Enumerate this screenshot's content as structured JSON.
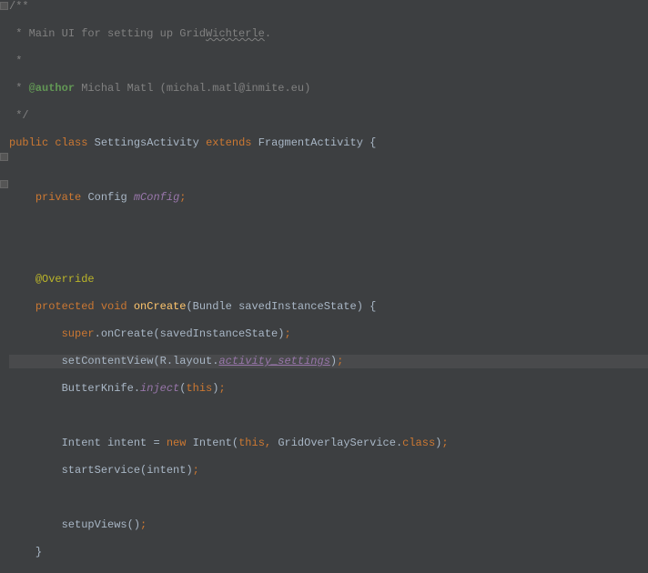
{
  "doc": {
    "open": "/**",
    "l1_prefix": " * ",
    "l1_a": "Main UI for setting up Grid",
    "l1_b": "Wichterle",
    "l1_c": ".",
    "star": " *",
    "l3_prefix": " * ",
    "author_tag": "@author",
    "author_val": " Michal Matl (michal.matl@inmite.eu)",
    "close": " */"
  },
  "k": {
    "public": "public",
    "class": "class",
    "extends": "extends",
    "private": "private",
    "protected": "protected",
    "void": "void",
    "super": "super",
    "new": "new",
    "this": "this",
    "classkw": "class"
  },
  "cls": {
    "name": "SettingsActivity",
    "parent": "FragmentActivity",
    "Config": "Config",
    "Bundle": "Bundle",
    "R": "R",
    "layout": "layout",
    "ButterKnife": "ButterKnife",
    "Intent": "Intent",
    "GridOverlayService": "GridOverlayService"
  },
  "id": {
    "mConfig": "mConfig",
    "onCreate": "onCreate",
    "savedInstanceState": "savedInstanceState",
    "setContentView": "setContentView",
    "activity_settings": "activity_settings",
    "inject": "inject",
    "intent": "intent",
    "startService": "startService",
    "setupViews": "setupViews"
  },
  "ann": {
    "Override": "@Override"
  },
  "p": {
    "sp": " ",
    "sp4": "    ",
    "sp8": "        ",
    "obrace": " {",
    "cbrace": "}",
    "semi": ";",
    "dot": ".",
    "comma": ", ",
    "op": "(",
    "cp": ")",
    "eq": " = "
  }
}
